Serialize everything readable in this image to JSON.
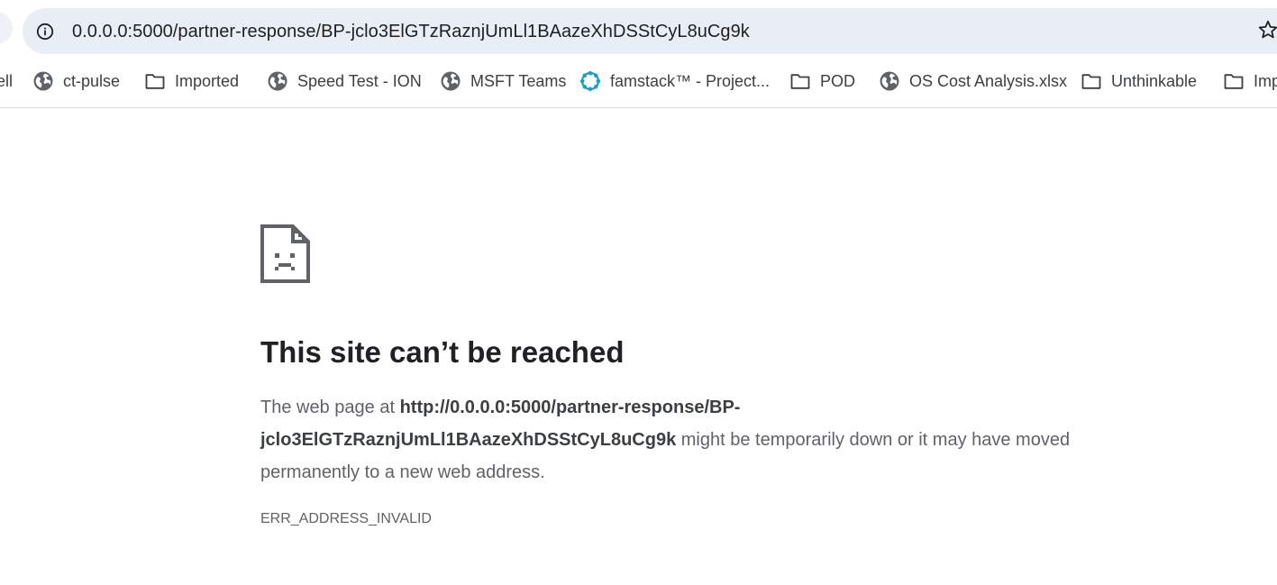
{
  "browser": {
    "url": "0.0.0.0:5000/partner-response/BP-jclo3ElGTzRaznjUmLl1BAazeXhDSStCyL8uCg9k",
    "icons": {
      "site_info": "info-icon",
      "bookmark": "star-icon"
    }
  },
  "bookmarks": [
    {
      "label": "ell",
      "icon": "none"
    },
    {
      "label": "ct-pulse",
      "icon": "globe-icon"
    },
    {
      "label": "Imported",
      "icon": "folder-icon"
    },
    {
      "label": "Speed Test - ION",
      "icon": "globe-icon"
    },
    {
      "label": "MSFT Teams",
      "icon": "globe-icon"
    },
    {
      "label": "famstack™ - Project...",
      "icon": "famstack-icon"
    },
    {
      "label": "POD",
      "icon": "folder-icon"
    },
    {
      "label": "OS Cost Analysis.xlsx",
      "icon": "globe-icon"
    },
    {
      "label": "Unthinkable",
      "icon": "folder-icon"
    },
    {
      "label": "Imp",
      "icon": "folder-icon"
    }
  ],
  "error": {
    "icon": "sad-file-icon",
    "title": "This site can’t be reached",
    "desc_prefix": "The web page at ",
    "desc_url_line1": "http://0.0.0.0:5000/partner-response/BP-",
    "desc_url_line2": "jclo3ElGTzRaznjUmLl1BAazeXhDSStCyL8uCg9k",
    "desc_suffix": " might be temporarily down or it may have moved permanently to a new web address.",
    "code": "ERR_ADDRESS_INVALID"
  },
  "colors": {
    "omnibox_bg": "#e9eef6",
    "text_primary": "#202124",
    "text_secondary": "#5f6368",
    "famstack_accent": "#1ba1c4"
  }
}
